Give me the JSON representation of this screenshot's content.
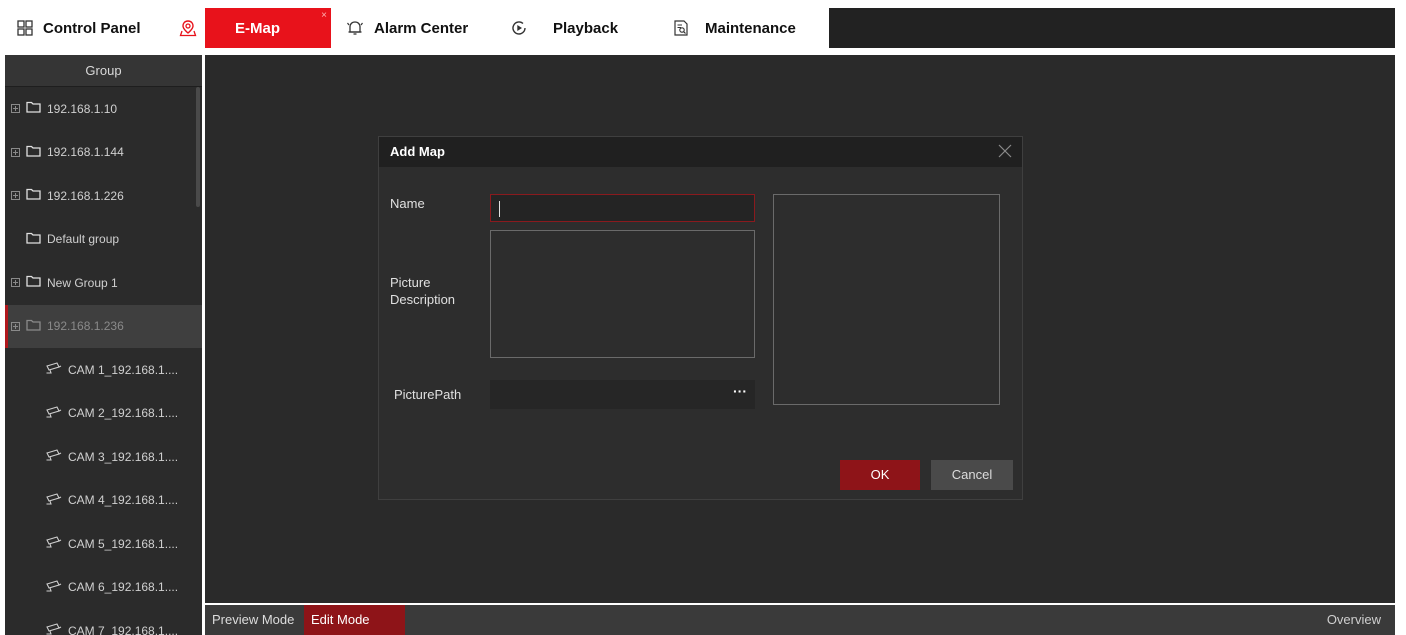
{
  "tabs": [
    {
      "label": "Control Panel",
      "icon": "grid-icon",
      "active": false
    },
    {
      "label": "E-Map",
      "icon": "map-pin-icon",
      "active": true,
      "close": "×"
    },
    {
      "label": "Alarm Center",
      "icon": "bell-icon",
      "active": false
    },
    {
      "label": "Playback",
      "icon": "play-circle-icon",
      "active": false
    },
    {
      "label": "Maintenance",
      "icon": "report-search-icon",
      "active": false
    }
  ],
  "sidebar": {
    "header": "Group",
    "groups": [
      {
        "label": "192.168.1.10",
        "expandable": true
      },
      {
        "label": "192.168.1.144",
        "expandable": true
      },
      {
        "label": "192.168.1.226",
        "expandable": true
      },
      {
        "label": "Default group",
        "expandable": false
      },
      {
        "label": "New Group 1",
        "expandable": true
      },
      {
        "label": "192.168.1.236",
        "expandable": true,
        "selected": true
      }
    ],
    "cameras": [
      {
        "label": "CAM 1_192.168.1...."
      },
      {
        "label": "CAM 2_192.168.1...."
      },
      {
        "label": "CAM 3_192.168.1...."
      },
      {
        "label": "CAM 4_192.168.1...."
      },
      {
        "label": "CAM 5_192.168.1...."
      },
      {
        "label": "CAM 6_192.168.1...."
      },
      {
        "label": "CAM 7_192.168.1...."
      }
    ]
  },
  "dialog": {
    "title": "Add Map",
    "name_label": "Name",
    "name_value": "",
    "description_label_line1": "Picture",
    "description_label_line2": "Description",
    "description_value": "",
    "path_label": "PicturePath",
    "path_value": "",
    "browse_label": "···",
    "ok_label": "OK",
    "cancel_label": "Cancel"
  },
  "bottombar": {
    "preview_mode": "Preview Mode",
    "edit_mode": "Edit Mode",
    "overview": "Overview"
  },
  "colors": {
    "accent": "#e8121b",
    "accent_dark": "#8e1418",
    "panel": "#2a2a2a",
    "sidebar": "#2b2b2b"
  }
}
